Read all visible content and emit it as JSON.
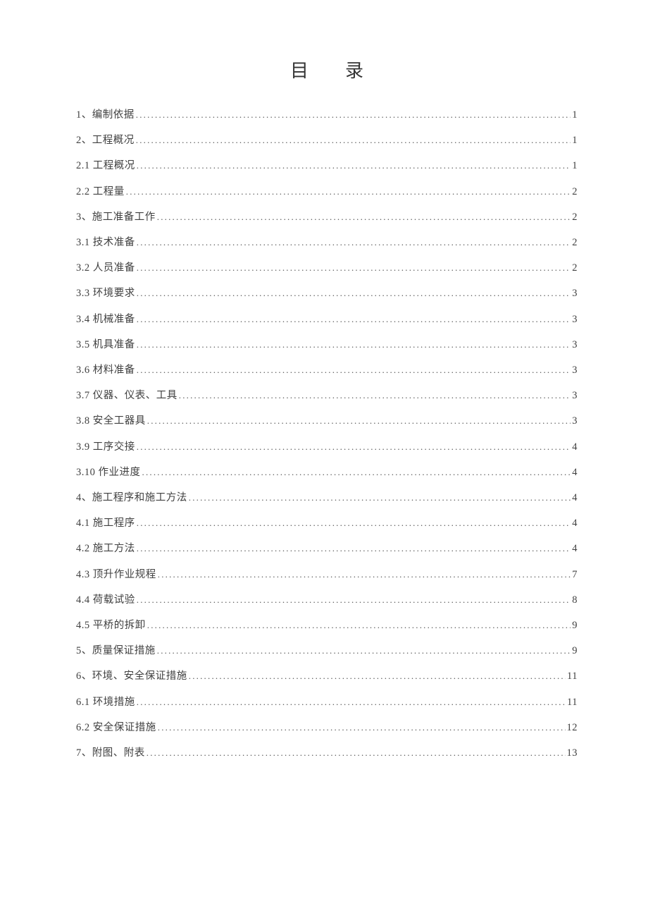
{
  "title": "目录",
  "toc": [
    {
      "label": "1、编制依据",
      "page": "1"
    },
    {
      "label": "2、工程概况",
      "page": "1"
    },
    {
      "label": "2.1 工程概况",
      "page": "1"
    },
    {
      "label": "2.2 工程量",
      "page": "2"
    },
    {
      "label": "3、施工准备工作",
      "page": "2"
    },
    {
      "label": "3.1 技术准备",
      "page": "2"
    },
    {
      "label": "3.2 人员准备",
      "page": "2"
    },
    {
      "label": "3.3 环境要求",
      "page": "3"
    },
    {
      "label": "3.4 机械准备",
      "page": "3"
    },
    {
      "label": "3.5 机具准备",
      "page": "3"
    },
    {
      "label": "3.6 材料准备",
      "page": "3"
    },
    {
      "label": "3.7 仪器、仪表、工具",
      "page": "3"
    },
    {
      "label": "3.8 安全工器具",
      "page": "3"
    },
    {
      "label": "3.9 工序交接",
      "page": "4"
    },
    {
      "label": "3.10 作业进度",
      "page": "4"
    },
    {
      "label": "4、施工程序和施工方法",
      "page": "4"
    },
    {
      "label": "4.1 施工程序",
      "page": "4"
    },
    {
      "label": "4.2 施工方法",
      "page": "4"
    },
    {
      "label": "4.3 顶升作业规程",
      "page": "7"
    },
    {
      "label": "4.4 荷载试验",
      "page": "8"
    },
    {
      "label": "4.5 平桥的拆卸",
      "page": "9"
    },
    {
      "label": "5、质量保证措施",
      "page": "9"
    },
    {
      "label": "6、环境、安全保证措施",
      "page": "11"
    },
    {
      "label": "6.1 环境措施",
      "page": "11"
    },
    {
      "label": "6.2 安全保证措施",
      "page": "12"
    },
    {
      "label": "7、附图、附表",
      "page": "13"
    }
  ]
}
